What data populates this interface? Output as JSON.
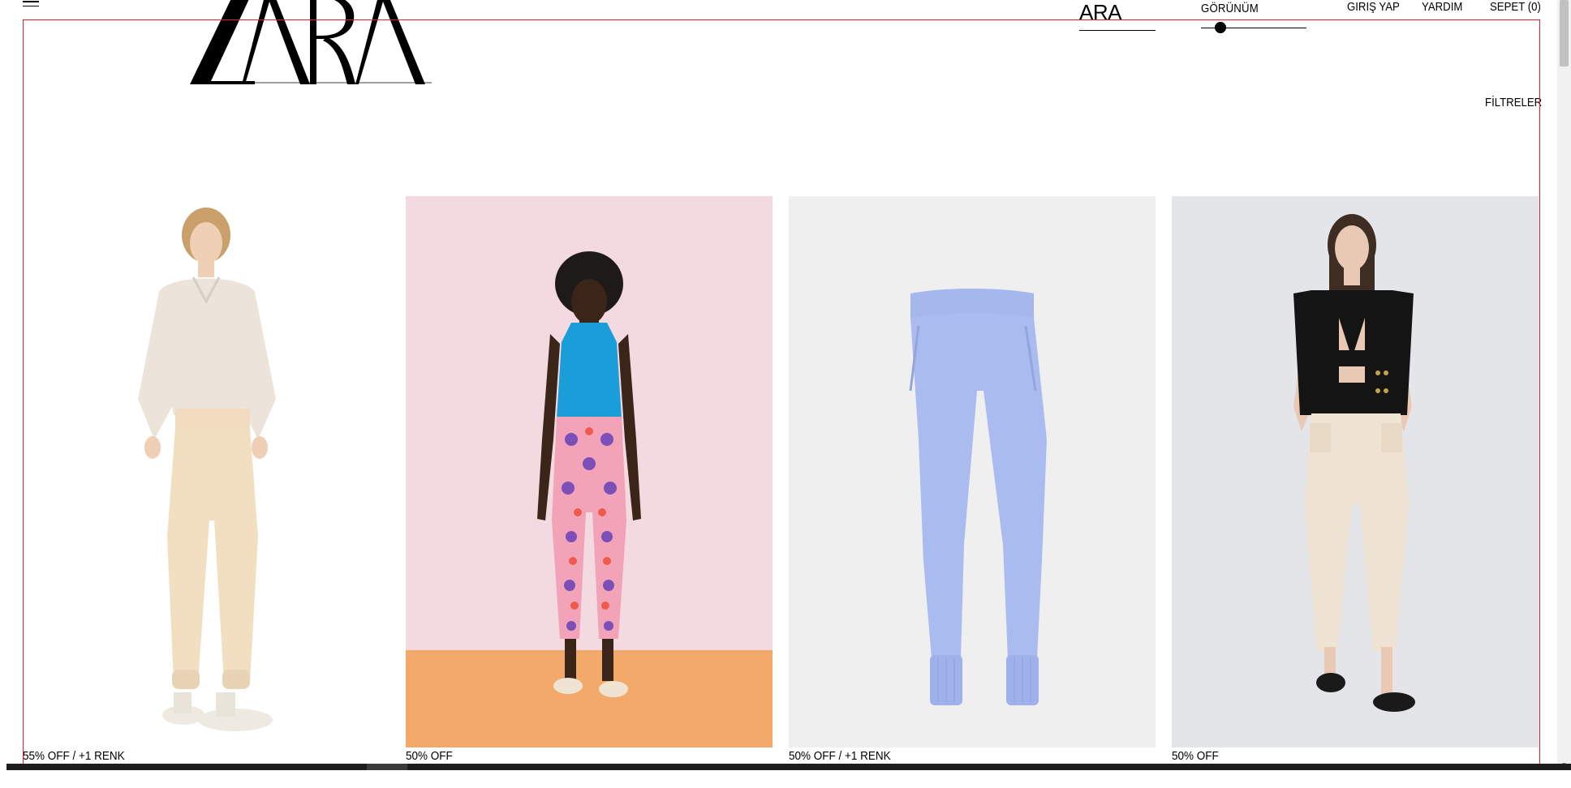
{
  "brand": {
    "logo_text": "ZARA"
  },
  "header": {
    "search_label": "ARA",
    "view_label": "GÖRÜNÜM",
    "view_level": 0.15,
    "nav": {
      "login": "GIRIŞ YAP",
      "help": "YARDIM",
      "cart": "SEPET (0)"
    },
    "filters_label": "FİLTRELER"
  },
  "products": [
    {
      "caption": "55% OFF / +1 RENK",
      "image": "woman-satin-shirt-beige-joggers"
    },
    {
      "caption": "50% OFF",
      "image": "woman-blue-halter-printed-trousers"
    },
    {
      "caption": "50% OFF / +1 RENK",
      "image": "lilac-jogger-pants-flatlay"
    },
    {
      "caption": "50% OFF",
      "image": "woman-black-vest-cream-trousers"
    }
  ],
  "icons": {
    "menu": "hamburger-menu-icon",
    "scroll_down": "chevron-down-icon"
  },
  "colors": {
    "text": "#000000",
    "background": "#ffffff",
    "selection_outline": "#e0202a"
  }
}
